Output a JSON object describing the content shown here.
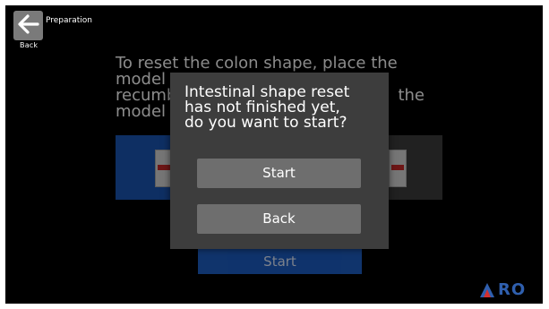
{
  "header": {
    "title": "Preparation",
    "back_caption": "Back"
  },
  "background": {
    "instruction_lines": [
      "To reset the colon shape, place the",
      "model",
      "recumb",
      "model"
    ],
    "instruction_tail_word": "the",
    "start_label": "Start"
  },
  "dialog": {
    "message": "Intestinal shape reset\nhas not finished yet,\ndo you want to start?",
    "start_label": "Start",
    "back_label": "Back"
  },
  "logo": {
    "text": "RO"
  },
  "colors": {
    "screen_bg": "#000000",
    "modal_bg": "#3d3d3d",
    "button_bg": "#6e6e6e",
    "accent_blue": "#1a56b4",
    "logo_red": "#d32f2f"
  },
  "icons": {
    "back": "arrow-left-icon"
  }
}
